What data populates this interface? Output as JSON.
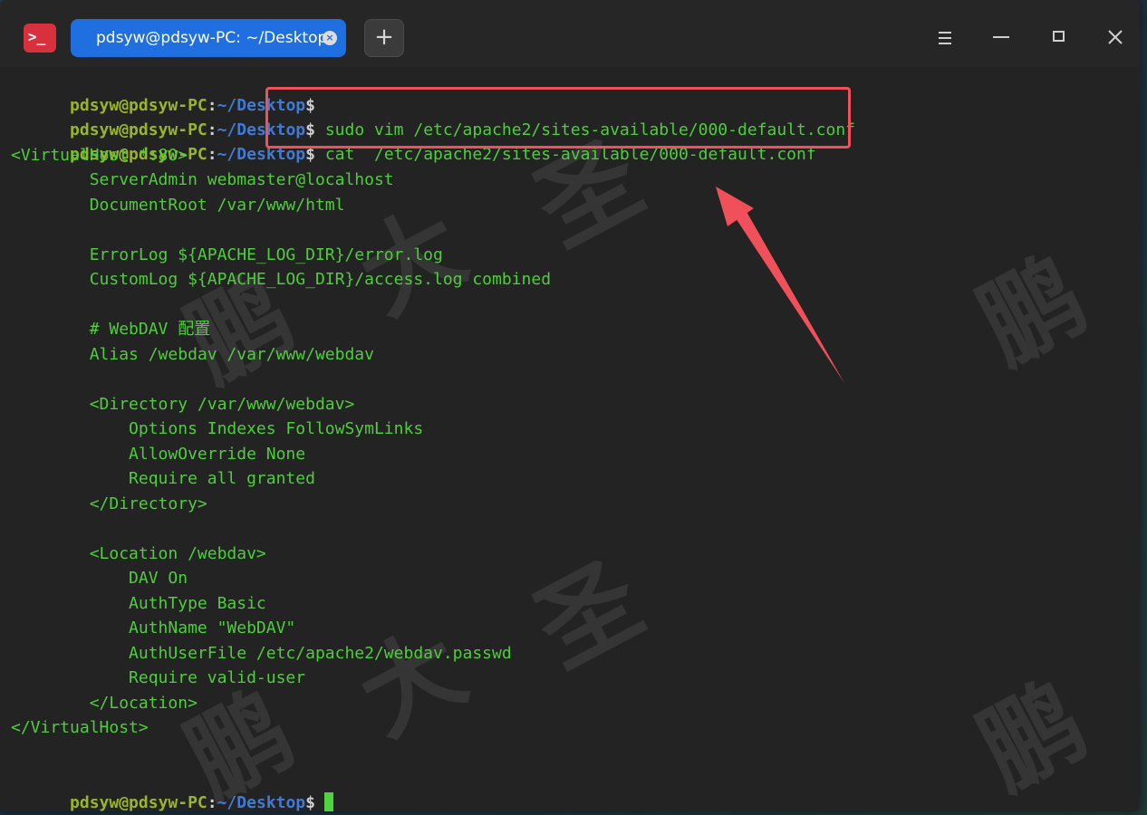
{
  "window": {
    "tab_title": "pdsyw@pdsyw-PC: ~/Desktop",
    "tab_close": "×",
    "new_tab": "+",
    "app_icon_glyph": ">_"
  },
  "prompt": {
    "user": "pdsyw@pdsyw-PC",
    "colon": ":",
    "path": "~/Desktop",
    "dollar": "$"
  },
  "commands": {
    "line2": "sudo vim /etc/apache2/sites-available/000-default.conf",
    "line3": "cat  /etc/apache2/sites-available/000-default.conf"
  },
  "output": [
    "<VirtualHost *:80>",
    "        ServerAdmin webmaster@localhost",
    "        DocumentRoot /var/www/html",
    "",
    "        ErrorLog ${APACHE_LOG_DIR}/error.log",
    "        CustomLog ${APACHE_LOG_DIR}/access.log combined",
    "",
    "        # WebDAV 配置",
    "        Alias /webdav /var/www/webdav",
    "",
    "        <Directory /var/www/webdav>",
    "            Options Indexes FollowSymLinks",
    "            AllowOverride None",
    "            Require all granted",
    "        </Directory>",
    "",
    "        <Location /webdav>",
    "            DAV On",
    "            AuthType Basic",
    "            AuthName \"WebDAV\"",
    "            AuthUserFile /etc/apache2/webdav.passwd",
    "            Require valid-user",
    "        </Location>",
    "</VirtualHost>"
  ],
  "watermark": [
    "鹏",
    "大",
    "圣"
  ],
  "colors": {
    "user": "#99b52b",
    "path": "#3f7bd6",
    "text": "#4fcd3d",
    "highlight": "#f0505a",
    "tab": "#1f6fe0"
  }
}
